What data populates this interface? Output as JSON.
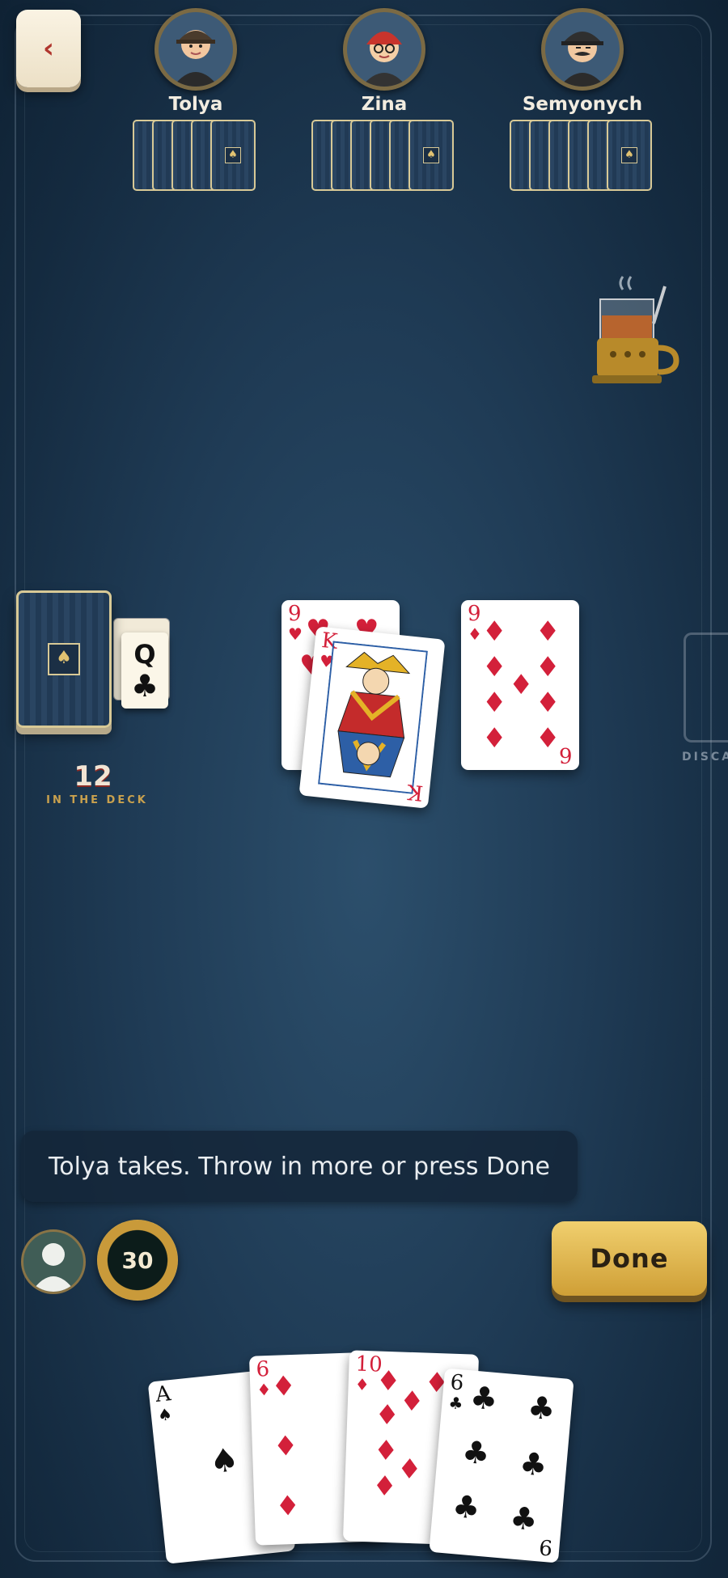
{
  "back_icon": "chevron-left-icon",
  "opponents": [
    {
      "name": "Tolya",
      "cards": 5,
      "avatar": "man-with-cap"
    },
    {
      "name": "Zina",
      "cards": 6,
      "avatar": "woman-with-red-hat"
    },
    {
      "name": "Semyonych",
      "cards": 6,
      "avatar": "man-with-mustache"
    }
  ],
  "deck": {
    "count": "12",
    "label": "IN THE DECK",
    "trump_rank": "Q",
    "trump_suit": "♣"
  },
  "table": {
    "attack1": {
      "rank": "9",
      "suit": "♥"
    },
    "defend1": {
      "rank": "K",
      "suit": "♥"
    },
    "attack2": {
      "rank": "9",
      "suit": "♦",
      "bottom_rank": "6"
    }
  },
  "discard_label": "DISCARD",
  "status_text": "Tolya takes. Throw in more or press Done",
  "timer": "30",
  "done_label": "Done",
  "hand": [
    {
      "rank": "A",
      "suit": "♠"
    },
    {
      "rank": "6",
      "suit": "♦"
    },
    {
      "rank": "10",
      "suit": "♦"
    },
    {
      "rank": "6",
      "suit": "♣",
      "bottom_rank": "9"
    }
  ],
  "colors": {
    "red_suit": "#d3203a",
    "gold": "#e5c36a",
    "background": "#1f3b55"
  }
}
